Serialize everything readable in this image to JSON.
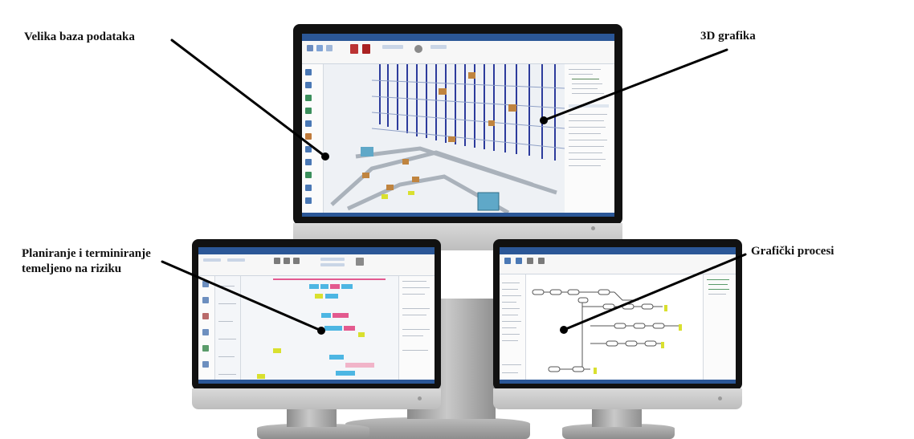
{
  "callouts": {
    "database": "Velika baza podataka",
    "graphics3d": "3D grafika",
    "risk_planning_line1": "Planiranje i terminiranje",
    "risk_planning_line2": "temeljeno na riziku",
    "process_graphics": "Grafički procesi"
  },
  "colors": {
    "callout_line": "#000000",
    "app_titlebar": "#2b5797",
    "monitor_bezel": "#111111",
    "monitor_chin": "#c8c8c8",
    "rack_blue": "#2c3b9c",
    "box_orange": "#c0843f",
    "machine_teal": "#5fa8c8",
    "gantt_pink": "#e35a8f",
    "gantt_cyan": "#4db6e3",
    "gantt_yellow": "#d9e02f"
  },
  "icons": {
    "top_app": "warehouse-3d-app-icon",
    "left_app": "gantt-scheduler-app-icon",
    "right_app": "process-flow-app-icon"
  }
}
